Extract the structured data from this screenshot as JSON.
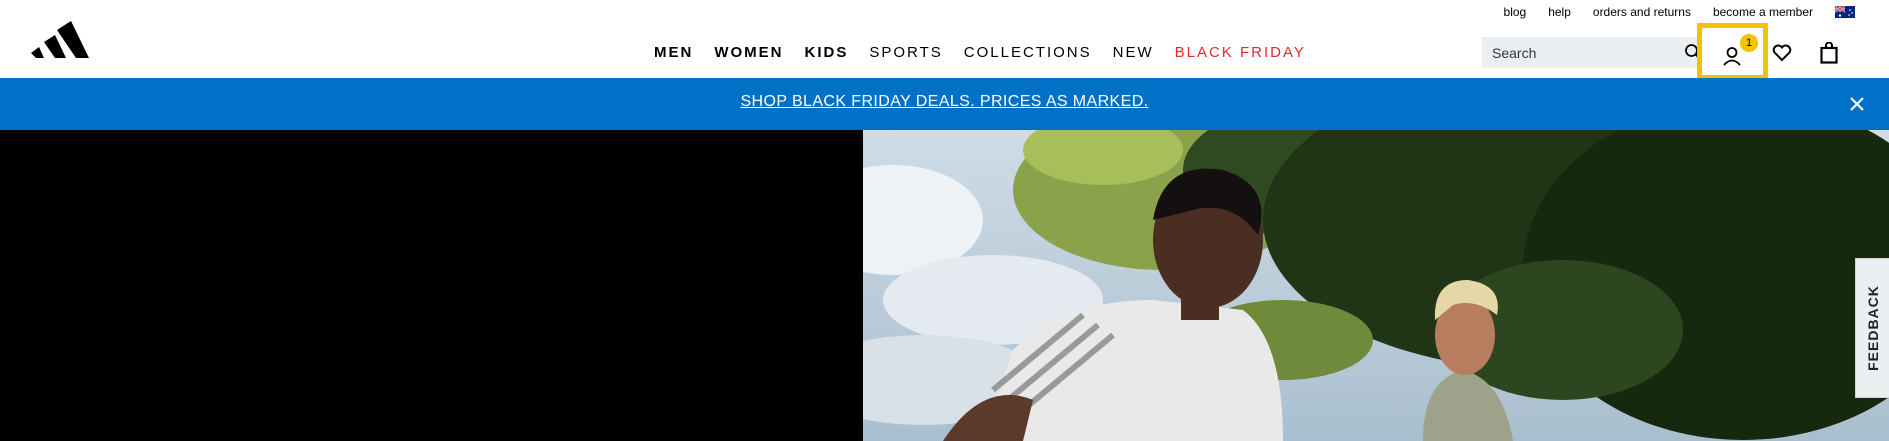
{
  "header": {
    "logo": "adidas-logo",
    "utility_links": [
      "blog",
      "help",
      "orders and returns",
      "become a member"
    ],
    "nav": [
      {
        "label": "MEN",
        "style": "bold"
      },
      {
        "label": "WOMEN",
        "style": "bold"
      },
      {
        "label": "KIDS",
        "style": "bold"
      },
      {
        "label": "SPORTS",
        "style": "normal"
      },
      {
        "label": "COLLECTIONS",
        "style": "normal"
      },
      {
        "label": "NEW",
        "style": "normal"
      },
      {
        "label": "BLACK FRIDAY",
        "style": "red"
      }
    ],
    "search": {
      "placeholder": "Search",
      "value": ""
    },
    "account_badge": "1",
    "colors": {
      "nav_highlight": "#e32b2b",
      "focus_outline": "#f5c100",
      "badge": "#f5c100"
    }
  },
  "promo": {
    "text": "SHOP BLACK FRIDAY DEALS. PRICES AS MARKED.",
    "background": "#0071c7"
  },
  "feedback_tab": "FEEDBACK"
}
